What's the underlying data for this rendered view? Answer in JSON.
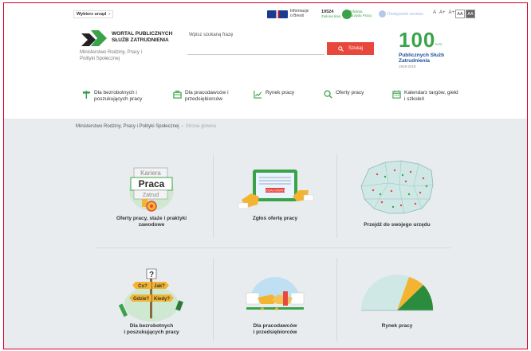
{
  "topbar": {
    "office_select": "Wybierz urząd",
    "brexit_line1": "Informacje",
    "brexit_line2": "o Brexit",
    "hotline_number": "19524",
    "hotline_sub": "Zielona linia",
    "infoline_line1": "Infolinia",
    "infoline_line2": "Urzędu Pracy",
    "accessibility": "Dostępność serwisu",
    "font_sizes": [
      "A",
      "A+",
      "A++"
    ],
    "contrast": [
      "AA",
      "AA"
    ]
  },
  "header": {
    "logo_line1": "WORTAL PUBLICZNYCH",
    "logo_line2": "SŁUŻB ZATRUDNIENIA",
    "logo_sub1": "Ministerstwo Rodziny, Pracy i",
    "logo_sub2": "Polityki Społecznej",
    "search_label": "Wpisz szukaną frazę",
    "search_placeholder": "",
    "search_button": "Szukaj",
    "anniv_number": "100",
    "anniv_lata": "lecie",
    "anniv_title1": "Publicznych Służb",
    "anniv_title2": "Zatrudnienia",
    "anniv_years": "1919-2019"
  },
  "nav": {
    "items": [
      {
        "line1": "Dla bezrobotnych i",
        "line2": "poszukujących pracy",
        "icon": "signpost-icon"
      },
      {
        "line1": "Dla pracodawców i",
        "line2": "przedsiębiorców",
        "icon": "briefcase-icon"
      },
      {
        "line1": "Rynek pracy",
        "line2": "",
        "icon": "chart-icon"
      },
      {
        "line1": "Oferty pracy",
        "line2": "",
        "icon": "search-icon"
      },
      {
        "line1": "Kalendarz targów, giełd",
        "line2": "i szkoleń",
        "icon": "calendar-icon"
      }
    ]
  },
  "breadcrumb": {
    "root": "Ministerstwo Rodziny, Pracy i Polityki Społecznej",
    "current": "Strona główna"
  },
  "tiles": [
    {
      "line1": "Oferty pracy, staże i praktyki",
      "line2": "zawodowe"
    },
    {
      "line1": "Zgłoś ofertę pracy",
      "line2": ""
    },
    {
      "line1": "Przejdź do swojego urzędu",
      "line2": ""
    },
    {
      "line1": "Dla bezrobotnych",
      "line2": "i poszukujących pracy"
    },
    {
      "line1": "Dla pracodawców",
      "line2": "i przedsiębiorców"
    },
    {
      "line1": "Rynek pracy",
      "line2": ""
    }
  ],
  "illustrations": {
    "kariera_top": "Kariera",
    "kariera_mid": "Praca",
    "kariera_bottom": "Zatrud",
    "tablet_button": "DODAJ OFERTĘ",
    "questions": [
      "Co?",
      "Jak?",
      "Gdzie?",
      "Kiedy?",
      "?"
    ]
  },
  "colors": {
    "accent_green": "#3aa34a",
    "search_red": "#e8473c",
    "brand_blue": "#1e4e9c",
    "frame_red": "#d6002a"
  }
}
